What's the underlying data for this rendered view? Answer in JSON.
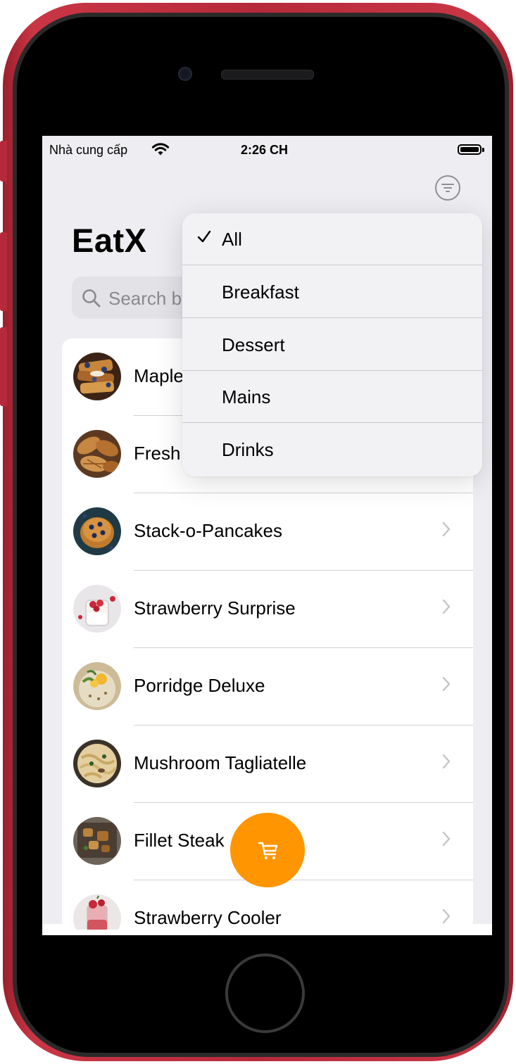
{
  "status_bar": {
    "carrier": "Nhà cung cấp",
    "time": "2:26 CH"
  },
  "app": {
    "title": "EatX"
  },
  "search": {
    "placeholder": "Search by name"
  },
  "menu_items": [
    {
      "label": "Maple French Toast",
      "photo": "toast-photo"
    },
    {
      "label": "Fresh Croissants",
      "photo": "croissant-photo"
    },
    {
      "label": "Stack-o-Pancakes",
      "photo": "pancake-photo"
    },
    {
      "label": "Strawberry Surprise",
      "photo": "dessert-photo"
    },
    {
      "label": "Porridge Deluxe",
      "photo": "porridge-photo"
    },
    {
      "label": "Mushroom Tagliatelle",
      "photo": "pasta-photo"
    },
    {
      "label": "Fillet Steak",
      "photo": "steak-photo"
    },
    {
      "label": "Strawberry Cooler",
      "photo": "drink-photo"
    }
  ],
  "filter_menu": {
    "selected": "All",
    "options": [
      {
        "label": "All",
        "checked": true
      },
      {
        "label": "Breakfast",
        "checked": false
      },
      {
        "label": "Dessert",
        "checked": false
      },
      {
        "label": "Mains",
        "checked": false
      },
      {
        "label": "Drinks",
        "checked": false
      }
    ]
  },
  "icons": {
    "filter": "line-3-horizontal-decrease-circle-icon",
    "search": "magnifying-glass-icon",
    "cart": "cart-icon",
    "check": "checkmark-icon",
    "chevron": "chevron-right-icon",
    "wifi": "wifi-icon",
    "battery": "battery-icon"
  },
  "colors": {
    "phone_frame": "#c93645",
    "accent_orange": "#ff9500",
    "screen_background": "#eeeef2",
    "separator": "#d1d1d6"
  }
}
